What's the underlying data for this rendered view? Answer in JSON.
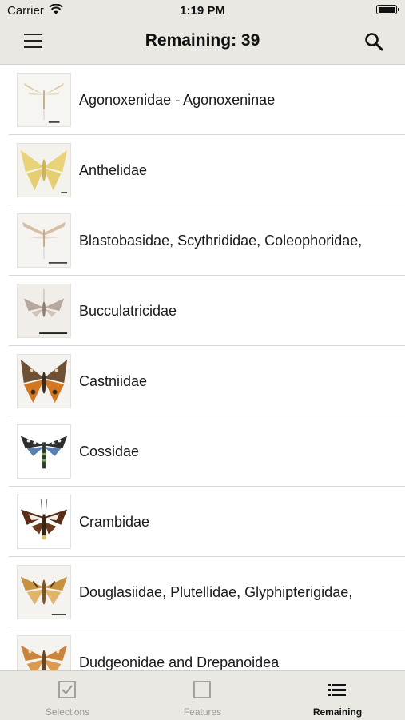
{
  "status_bar": {
    "carrier": "Carrier",
    "time": "1:19 PM"
  },
  "nav": {
    "title": "Remaining: 39",
    "menu_icon": "hamburger-menu-icon",
    "search_icon": "search-icon"
  },
  "items": [
    {
      "label": "Agonoxenidae - Agonoxeninae"
    },
    {
      "label": "Anthelidae"
    },
    {
      "label": "Blastobasidae, Scythrididae, Coleophoridae,"
    },
    {
      "label": "Bucculatricidae"
    },
    {
      "label": "Castniidae"
    },
    {
      "label": "Cossidae"
    },
    {
      "label": "Crambidae"
    },
    {
      "label": "Douglasiidae, Plutellidae, Glyphipterigidae,"
    },
    {
      "label": "Dudgeonidae and Drepanoidea"
    }
  ],
  "tabs": [
    {
      "label": "Selections",
      "icon": "checkbox-checked-icon",
      "active": false
    },
    {
      "label": "Features",
      "icon": "checkbox-empty-icon",
      "active": false
    },
    {
      "label": "Remaining",
      "icon": "list-icon",
      "active": true
    }
  ]
}
